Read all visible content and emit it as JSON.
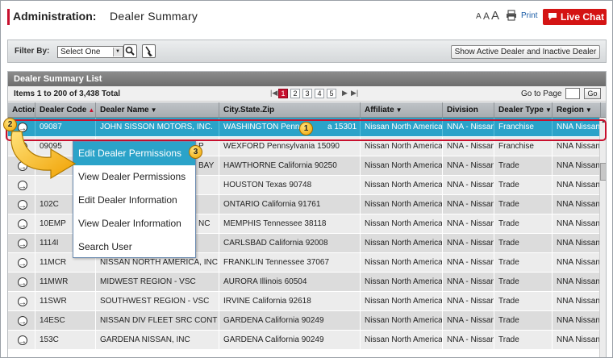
{
  "header": {
    "section": "Administration:",
    "page": "Dealer Summary",
    "font_small": "A",
    "font_med": "A",
    "font_large": "A",
    "print_label": "Print",
    "live_chat_label": "Live Chat"
  },
  "filter": {
    "label": "Filter By:",
    "select_value": "Select One",
    "show_button": "Show Active Dealer and Inactive Dealer"
  },
  "list": {
    "title": "Dealer Summary List",
    "items_text": "Items 1 to 200 of 3,438 Total",
    "pages": [
      "1",
      "2",
      "3",
      "4",
      "5"
    ],
    "current_page": "1",
    "goto_label": "Go to Page",
    "go_button": "Go"
  },
  "columns": [
    "Action",
    "Dealer Code",
    "Dealer Name",
    "City.State.Zip",
    "Affiliate",
    "Division",
    "Dealer Type",
    "Region"
  ],
  "rows": [
    {
      "code": "09087",
      "name": "JOHN SISSON MOTORS, INC.",
      "city": "WASHINGTON Pennsy",
      "city2": "a 15301",
      "affiliate": "Nissan North America",
      "division": "NNA - Nissan",
      "type": "Franchise",
      "region": "NNA Nissan"
    },
    {
      "code": "09095",
      "name": "",
      "city": "WEXFORD Pennsylvania 15090",
      "affiliate": "Nissan North America",
      "division": "NNA - Nissan",
      "type": "Franchise",
      "region": "NNA Nissan"
    },
    {
      "code": "",
      "name": "",
      "city": "HAWTHORNE California 90250",
      "affiliate": "Nissan North America",
      "division": "NNA - Nissan",
      "type": "Trade",
      "region": "NNA Nissan"
    },
    {
      "code": "",
      "name": "",
      "city": "HOUSTON Texas 90748",
      "affiliate": "Nissan North America",
      "division": "NNA - Nissan",
      "type": "Trade",
      "region": "NNA Nissan"
    },
    {
      "code": "102C",
      "name": "",
      "city": "ONTARIO California 91761",
      "affiliate": "Nissan North America",
      "division": "NNA - Nissan",
      "type": "Trade",
      "region": "NNA Nissan"
    },
    {
      "code": "10EMP",
      "name": "",
      "city": "MEMPHIS Tennessee 38118",
      "affiliate": "Nissan North America",
      "division": "NNA - Nissan",
      "type": "Trade",
      "region": "NNA Nissan"
    },
    {
      "code": "1114I",
      "name": "",
      "city": "CARLSBAD California 92008",
      "affiliate": "Nissan North America",
      "division": "NNA - Nissan",
      "type": "Trade",
      "region": "NNA Nissan"
    },
    {
      "code": "11MCR",
      "name": "NISSAN NORTH AMERICA, INC",
      "city": "FRANKLIN Tennessee 37067",
      "affiliate": "Nissan North America",
      "division": "NNA - Nissan",
      "type": "Trade",
      "region": "NNA Nissan"
    },
    {
      "code": "11MWR",
      "name": "MIDWEST REGION - VSC",
      "city": "AURORA Illinois 60504",
      "affiliate": "Nissan North America",
      "division": "NNA - Nissan",
      "type": "Trade",
      "region": "NNA Nissan"
    },
    {
      "code": "11SWR",
      "name": "SOUTHWEST REGION - VSC",
      "city": "IRVINE California 92618",
      "affiliate": "Nissan North America",
      "division": "NNA - Nissan",
      "type": "Trade",
      "region": "NNA Nissan"
    },
    {
      "code": "14ESC",
      "name": "NISSAN DIV FLEET SRC CONT",
      "city": "GARDENA California 90249",
      "affiliate": "Nissan North America",
      "division": "NNA - Nissan",
      "type": "Trade",
      "region": "NNA Nissan"
    },
    {
      "code": "153C",
      "name": "GARDENA NISSAN, INC",
      "city": "GARDENA California 90249",
      "affiliate": "Nissan North America",
      "division": "NNA - Nissan",
      "type": "Trade",
      "region": "NNA Nissan"
    }
  ],
  "partial_names": {
    "r2": "P",
    "r3": "BAY",
    "r6": "NC"
  },
  "menu": [
    "Edit Dealer Permissions",
    "View Dealer Permissions",
    "Edit Dealer Information",
    "View Dealer Information",
    "Search User"
  ],
  "callouts": [
    "1",
    "2",
    "3"
  ]
}
